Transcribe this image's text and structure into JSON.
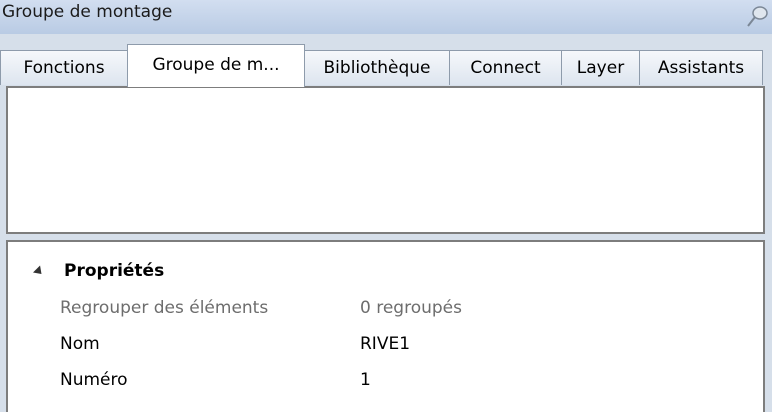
{
  "window": {
    "title": "Groupe de montage"
  },
  "tabs": [
    {
      "label": "Fonctions",
      "active": false
    },
    {
      "label": "Groupe de m...",
      "active": true
    },
    {
      "label": "Bibliothèque",
      "active": false
    },
    {
      "label": "Connect",
      "active": false
    },
    {
      "label": "Layer",
      "active": false
    },
    {
      "label": "Assistants",
      "active": false
    }
  ],
  "properties": {
    "section_title": "Propriétés",
    "rows": [
      {
        "name": "Regrouper des éléments",
        "value": "0 regroupés",
        "readonly": true
      },
      {
        "name": "Nom",
        "value": "RIVE1",
        "readonly": false
      },
      {
        "name": "Numéro",
        "value": "1",
        "readonly": false
      }
    ]
  },
  "icons": {
    "pin": "pin-icon",
    "collapse": "collapse-triangle-icon"
  }
}
